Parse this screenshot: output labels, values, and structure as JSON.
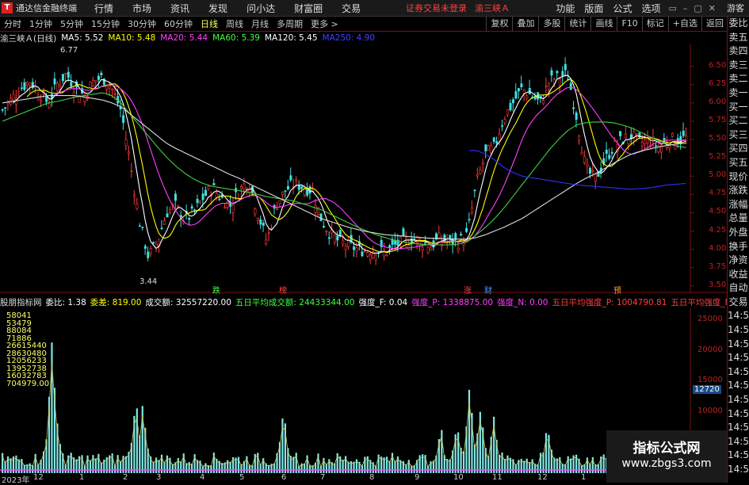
{
  "app": {
    "logo_text": "通达信金融终端",
    "menu": [
      "行情",
      "市场",
      "资讯",
      "发现",
      "问小达",
      "财富圈",
      "交易"
    ],
    "warning": "证券交易未登录",
    "stock_name": "渝三峡Ａ",
    "right_menu": [
      "功能",
      "版面",
      "公式",
      "选项"
    ],
    "guest": "游客",
    "win_buttons": [
      "▭",
      "–",
      "▢",
      "✕"
    ]
  },
  "periods": [
    "分时",
    "1分钟",
    "5分钟",
    "15分钟",
    "30分钟",
    "60分钟",
    "日线",
    "周线",
    "月线",
    "多周期",
    "更多 >"
  ],
  "active_period": "日线",
  "tools": [
    "复权",
    "叠加",
    "多股",
    "统计",
    "画线",
    "F10",
    "标记",
    "+自选",
    "返回"
  ],
  "ma_legend": {
    "title": "渝三峡Ａ(日线)",
    "items": [
      {
        "label": "MA5: 5.52",
        "color": "#ffffff"
      },
      {
        "label": "MA10: 5.48",
        "color": "#ffff00"
      },
      {
        "label": "MA20: 5.44",
        "color": "#ff40ff"
      },
      {
        "label": "MA60: 5.39",
        "color": "#40ff40"
      },
      {
        "label": "MA120: 5.45",
        "color": "#ffffff"
      },
      {
        "label": "MA250: 4.90",
        "color": "#4040ff"
      }
    ]
  },
  "side_panel": [
    "委比",
    "卖五",
    "卖四",
    "卖三",
    "卖二",
    "卖一",
    "买一",
    "买二",
    "买三",
    "买四",
    "买五",
    "现价",
    "涨跌",
    "涨幅",
    "总量",
    "外盘",
    "换手",
    "净资",
    "收益",
    "自动",
    "交易",
    "14:5",
    "14:5",
    "14:5",
    "14:5",
    "14:5",
    "14:5",
    "14:5",
    "14:5",
    "14:5",
    "14:5",
    "14:5",
    "14:5"
  ],
  "price_axis": [
    "6.50",
    "6.25",
    "6.00",
    "5.75",
    "5.50",
    "5.25",
    "5.00",
    "4.75",
    "4.50",
    "4.25",
    "4.00",
    "3.75",
    "3.50"
  ],
  "annotations": {
    "high": "6.77",
    "low": "3.44"
  },
  "flags": [
    {
      "text": "跌",
      "color": "#40ff40"
    },
    {
      "text": "榜",
      "color": "#ff4040"
    },
    {
      "text": "涨",
      "color": "#ff4040"
    },
    {
      "text": "财",
      "color": "#40a0ff"
    },
    {
      "text": "预",
      "color": "#ffa020"
    }
  ],
  "indicator": {
    "title": "股朋指标网",
    "items": [
      {
        "label": "委比: 1.38",
        "color": "#ffffff"
      },
      {
        "label": "委差: 819.00",
        "color": "#ffff00"
      },
      {
        "label": "成交额: 32557220.00",
        "color": "#ffffff"
      },
      {
        "label": "五日平均成交额: 24433344.00",
        "color": "#40ff40"
      },
      {
        "label": "强度_F: 0.04",
        "color": "#ffffff"
      },
      {
        "label": "强度_P: 1338875.00",
        "color": "#ff40ff"
      },
      {
        "label": "强度_N: 0.00",
        "color": "#ff40ff"
      },
      {
        "label": "五日平均强度_P: 1004790.81",
        "color": "#ff4040"
      },
      {
        "label": "五日平均强度_N: 0.00",
        "color": "#ff4040"
      }
    ]
  },
  "volume_axis": [
    "25000",
    "20000",
    "15000",
    "10000",
    "5000"
  ],
  "volume_current": "12720",
  "volume_values": [
    "58041",
    "53479",
    "88084",
    "71886",
    "26615440",
    "28630480",
    "12056233",
    "13952738",
    "16032783",
    "704979.00"
  ],
  "date_labels": [
    "2023年",
    "12",
    "1",
    "2",
    "3",
    "4",
    "5",
    "6",
    "7",
    "8",
    "9",
    "10",
    "11",
    "12",
    "1"
  ],
  "watermark": {
    "line1": "指标公式网",
    "line2": "www.zbgs3.com"
  },
  "chart_data": {
    "type": "candlestick",
    "title": "渝三峡Ａ(日线)",
    "ylim": [
      3.4,
      6.8
    ],
    "annotations": [
      {
        "label": "6.77",
        "value": 6.77
      },
      {
        "label": "3.44",
        "value": 3.44
      }
    ],
    "close_path": [
      5.9,
      6.05,
      6.2,
      6.3,
      6.15,
      6.0,
      6.25,
      6.4,
      6.2,
      6.1,
      6.3,
      6.35,
      6.2,
      5.9,
      5.2,
      4.4,
      3.9,
      4.1,
      4.5,
      4.6,
      4.4,
      4.5,
      4.7,
      4.85,
      4.7,
      4.6,
      4.8,
      4.95,
      4.5,
      4.1,
      4.6,
      4.8,
      4.9,
      4.85,
      4.8,
      4.4,
      4.2,
      4.1,
      4.05,
      4.0,
      3.98,
      4.0,
      3.95,
      4.05,
      4.1,
      4.15,
      4.1,
      4.05,
      4.15,
      4.1,
      4.1,
      4.2,
      4.9,
      5.3,
      5.4,
      5.8,
      6.0,
      6.2,
      6.1,
      6.0,
      6.3,
      6.35,
      6.4,
      5.8,
      5.1,
      4.95,
      5.2,
      5.4,
      5.5,
      5.55,
      5.45,
      5.5,
      5.4,
      5.5,
      5.5,
      5.52
    ],
    "series": [
      {
        "name": "MA250",
        "values": [
          null,
          null,
          null,
          null,
          null,
          null,
          null,
          null,
          null,
          null,
          null,
          null,
          null,
          null,
          null,
          null,
          null,
          null,
          null,
          null,
          null,
          null,
          null,
          null,
          null,
          null,
          null,
          null,
          null,
          null,
          null,
          null,
          null,
          null,
          null,
          null,
          null,
          null,
          null,
          null,
          null,
          null,
          null,
          null,
          null,
          null,
          null,
          null,
          null,
          null,
          null,
          null,
          5.35,
          5.3,
          5.22,
          5.12,
          5.05,
          5.0,
          4.98,
          4.96,
          4.94,
          4.92,
          4.9,
          4.88,
          4.87,
          4.86,
          4.85,
          4.84,
          4.83,
          4.82,
          4.83,
          4.84,
          4.86,
          4.88,
          4.89,
          4.9
        ]
      },
      {
        "name": "MA120",
        "values": [
          6.0,
          6.02,
          6.04,
          6.06,
          6.08,
          6.1,
          6.1,
          6.1,
          6.1,
          6.08,
          6.06,
          6.04,
          6.0,
          5.95,
          5.85,
          5.75,
          5.65,
          5.55,
          5.45,
          5.38,
          5.32,
          5.26,
          5.2,
          5.14,
          5.08,
          5.02,
          4.97,
          4.9,
          4.84,
          4.78,
          4.72,
          4.66,
          4.6,
          4.54,
          4.48,
          4.42,
          4.38,
          4.34,
          4.3,
          4.27,
          4.24,
          4.22,
          4.2,
          4.19,
          4.18,
          4.17,
          4.16,
          4.15,
          4.15,
          4.14,
          4.14,
          4.14,
          4.16,
          4.2,
          4.25,
          4.3,
          4.36,
          4.42,
          4.5,
          4.58,
          4.66,
          4.74,
          4.82,
          4.9,
          4.97,
          5.03,
          5.1,
          5.17,
          5.24,
          5.3,
          5.34,
          5.37,
          5.4,
          5.42,
          5.44,
          5.45
        ]
      },
      {
        "name": "MA60",
        "values": [
          5.75,
          5.8,
          5.85,
          5.9,
          5.95,
          6.0,
          6.02,
          6.05,
          6.08,
          6.1,
          6.12,
          6.14,
          6.1,
          6.0,
          5.85,
          5.7,
          5.55,
          5.4,
          5.26,
          5.14,
          5.04,
          4.96,
          4.9,
          4.86,
          4.84,
          4.82,
          4.8,
          4.78,
          4.75,
          4.72,
          4.7,
          4.68,
          4.66,
          4.62,
          4.58,
          4.54,
          4.48,
          4.42,
          4.36,
          4.3,
          4.25,
          4.2,
          4.16,
          4.12,
          4.1,
          4.08,
          4.07,
          4.06,
          4.06,
          4.06,
          4.07,
          4.1,
          4.2,
          4.3,
          4.42,
          4.56,
          4.72,
          4.88,
          5.04,
          5.2,
          5.36,
          5.5,
          5.62,
          5.7,
          5.73,
          5.74,
          5.74,
          5.73,
          5.7,
          5.66,
          5.6,
          5.54,
          5.48,
          5.44,
          5.41,
          5.39
        ]
      }
    ],
    "volume": {
      "ylim": [
        0,
        27000
      ],
      "ticks": [
        5000,
        10000,
        15000,
        20000,
        25000
      ],
      "current": 12720
    }
  }
}
